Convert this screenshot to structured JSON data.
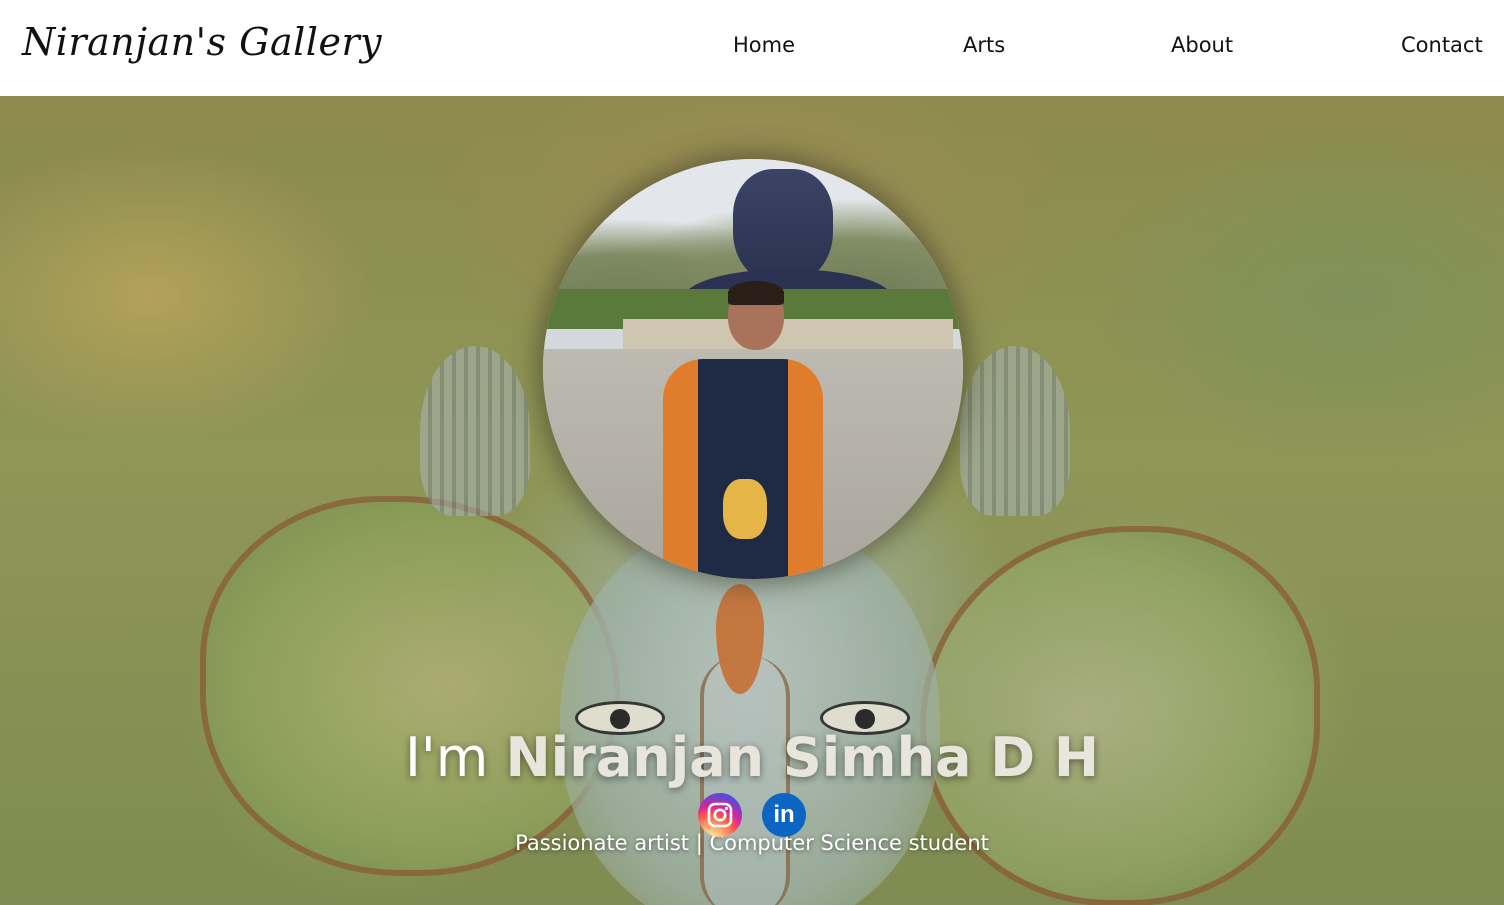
{
  "site": {
    "logo_text": "Niranjan's Gallery"
  },
  "nav": {
    "items": [
      {
        "label": "Home"
      },
      {
        "label": "Arts"
      },
      {
        "label": "About"
      },
      {
        "label": "Contact"
      }
    ]
  },
  "hero": {
    "title_prefix": "I'm",
    "title_name": "Niranjan Simha D H",
    "subtitle": "Passionate artist | Computer Science student",
    "social": [
      {
        "icon": "instagram-icon"
      },
      {
        "icon": "linkedin-icon",
        "glyph": "in"
      }
    ]
  },
  "colors": {
    "navbar_bg": "#ffffff",
    "text_dark": "#111111",
    "hero_text": "#ffffff",
    "linkedin_blue": "#0a66c2"
  }
}
